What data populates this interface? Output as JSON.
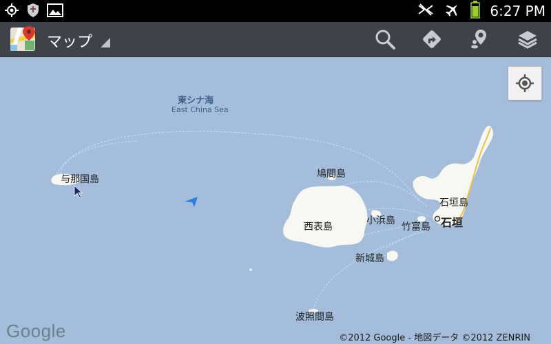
{
  "status_bar": {
    "left_icons": [
      "gps-icon",
      "shield-icon",
      "image-icon"
    ],
    "right_icons": [
      "signal-mute-icon",
      "airplane-mode-icon",
      "battery-icon"
    ],
    "time": "6:27 PM"
  },
  "action_bar": {
    "app_icon": "google-maps-app-icon",
    "title": "マップ",
    "actions": [
      "search-icon",
      "directions-icon",
      "places-icon",
      "layers-icon"
    ]
  },
  "map": {
    "sea_label_ja": "東シナ海",
    "sea_label_en": "East China Sea",
    "places": {
      "yonaguni": "与那国島",
      "hatoma": "鳩間島",
      "ishigaki_island": "石垣島",
      "iriomote": "西表島",
      "kohama": "小浜島",
      "taketomi": "竹富島",
      "ishigaki_city": "石垣",
      "aragusuku": "新城島",
      "hateruma": "波照間島"
    },
    "my_location_button_icon": "crosshair-icon",
    "logo": "Google",
    "copyright": "©2012 Google - 地図データ ©2012 ZENRIN"
  }
}
